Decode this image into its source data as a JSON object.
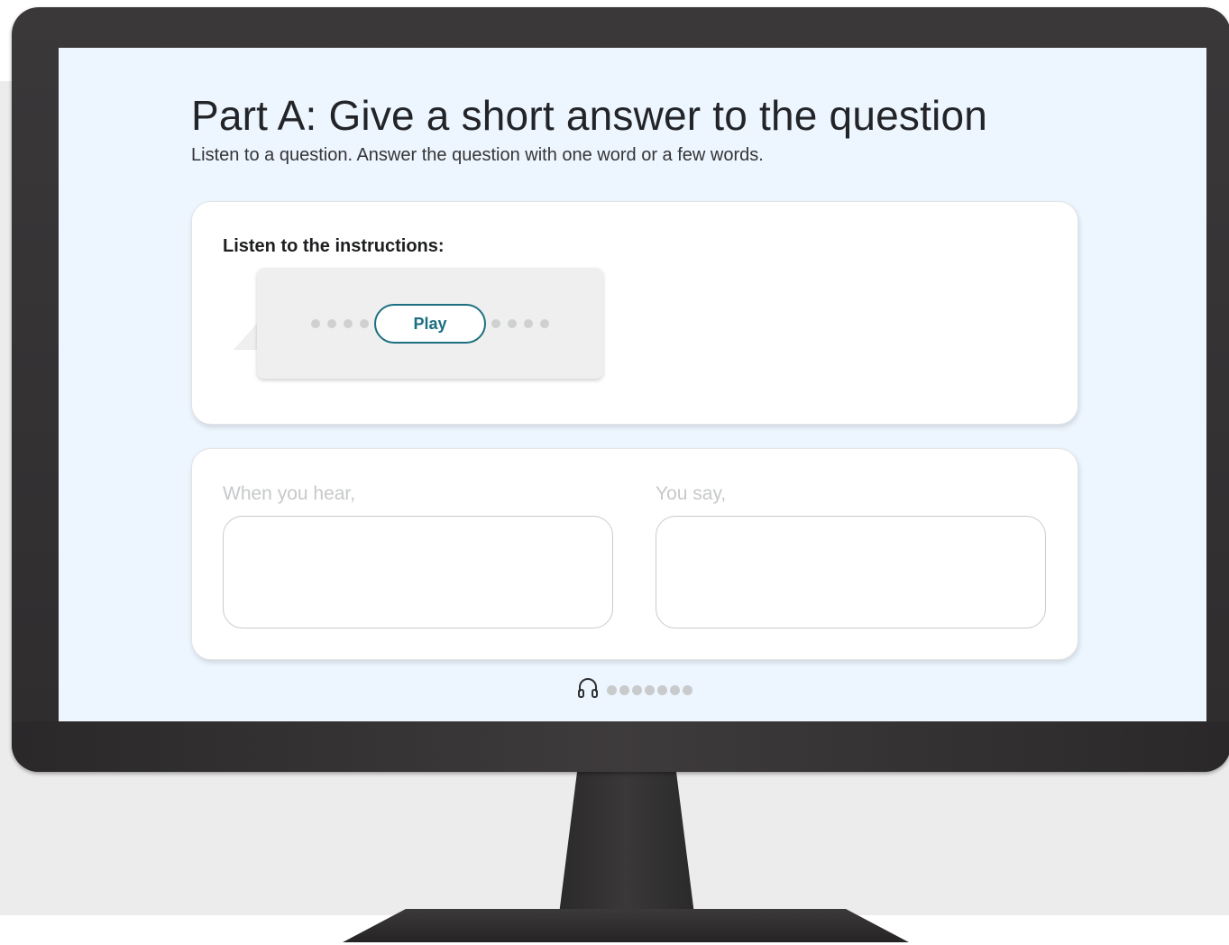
{
  "colors": {
    "screen_background": "#edf5fe",
    "accent": "#1b6f80",
    "monitor": "#2e2c2d"
  },
  "page": {
    "title": "Part A: Give a short answer to the question",
    "subtitle": "Listen to a question. Answer the question with one word or a few words."
  },
  "instructions": {
    "label": "Listen to the instructions:",
    "play_label": "Play"
  },
  "answer": {
    "hear_label": "When you hear,",
    "say_label": "You say,",
    "hear_value": "",
    "say_value": ""
  },
  "footer": {
    "icon": "headphones-icon"
  }
}
